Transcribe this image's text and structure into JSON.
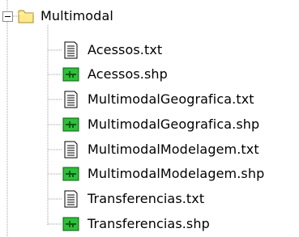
{
  "tree": {
    "root": {
      "label": "Multimodal",
      "icon": "folder-icon",
      "expanded": true,
      "expander_icon": "minus-expander-icon"
    },
    "children": [
      {
        "label": "Acessos.txt",
        "icon": "text-file-icon"
      },
      {
        "label": "Acessos.shp",
        "icon": "shapefile-icon"
      },
      {
        "label": "MultimodalGeografica.txt",
        "icon": "text-file-icon"
      },
      {
        "label": "MultimodalGeografica.shp",
        "icon": "shapefile-icon"
      },
      {
        "label": "MultimodalModelagem.txt",
        "icon": "text-file-icon"
      },
      {
        "label": "MultimodalModelagem.shp",
        "icon": "shapefile-icon"
      },
      {
        "label": "Transferencias.txt",
        "icon": "text-file-icon"
      },
      {
        "label": "Transferencias.shp",
        "icon": "shapefile-icon"
      }
    ]
  },
  "colors": {
    "folder_fill": "#ffe98a",
    "folder_outline": "#a88a2a",
    "shapefile_green": "#2fbf3a",
    "shapefile_dark": "#0a5c12",
    "tree_line": "#a0a0a0"
  }
}
